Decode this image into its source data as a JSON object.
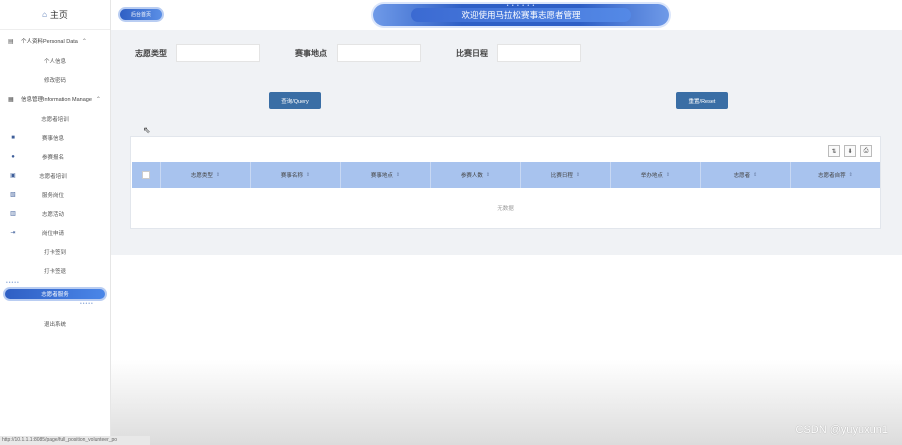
{
  "sidebar": {
    "home_label": "主页",
    "groups": [
      {
        "label": "个人资料Personal Data",
        "items": [
          "个人信息",
          "修改密码"
        ]
      },
      {
        "label": "信息管理Information Manage",
        "items": [
          "志愿者培训"
        ]
      }
    ],
    "icon_items": [
      {
        "icon": "bookmark-icon",
        "label": "赛事信息"
      },
      {
        "icon": "user-icon",
        "label": "参赛报名"
      },
      {
        "icon": "calendar-icon",
        "label": "志愿者培训"
      },
      {
        "icon": "document-icon",
        "label": "服务岗位"
      },
      {
        "icon": "book-icon",
        "label": "志愿活动"
      },
      {
        "icon": "logout-icon",
        "label": "岗位申请"
      }
    ],
    "plain_items": [
      "打卡签到",
      "打卡签退"
    ],
    "active_item": "志愿者服务",
    "last_item": "退出系统",
    "status_url": "http://10.1.1.1:8085/page/full_position_volunteer_po"
  },
  "header": {
    "home_tab": "后台首页",
    "title": "欢迎使用马拉松赛事志愿者管理"
  },
  "search": {
    "fields": [
      {
        "label": "志愿类型",
        "value": ""
      },
      {
        "label": "赛事地点",
        "value": ""
      },
      {
        "label": "比赛日程",
        "value": ""
      }
    ],
    "query_button": "查询/Query",
    "reset_button": "重置/Reset"
  },
  "table": {
    "columns": [
      "志愿类型",
      "赛事名称",
      "赛事地点",
      "参赛人数",
      "比赛日程",
      "举办地点",
      "志愿者",
      "志愿者自荐"
    ],
    "empty_text": "无数据"
  },
  "watermark": "CSDN @yuyuxun1"
}
